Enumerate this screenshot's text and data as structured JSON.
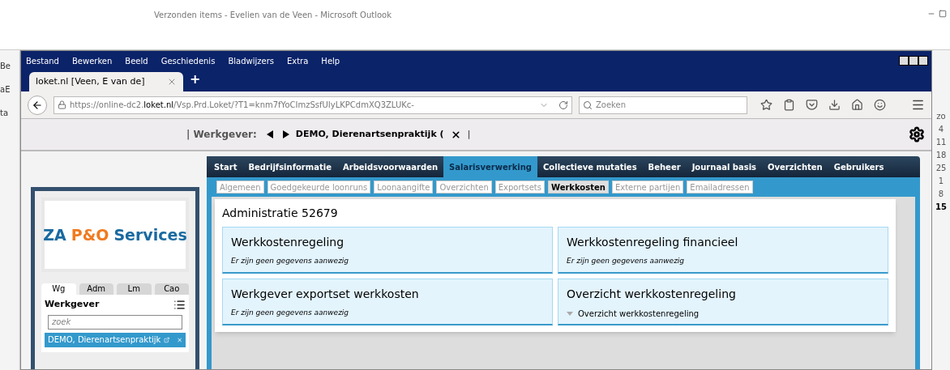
{
  "outlook": {
    "title": "Verzonden items - Evelien van de Veen  -  Microsoft Outlook",
    "left_fragments": [
      "Be",
      "aE",
      "ta"
    ],
    "calendar_days": [
      {
        "label": "zo",
        "bold": false
      },
      {
        "label": "4",
        "bold": false
      },
      {
        "label": "11",
        "bold": false
      },
      {
        "label": "18",
        "bold": false
      },
      {
        "label": "25",
        "bold": false
      },
      {
        "label": "1",
        "bold": false
      },
      {
        "label": "8",
        "bold": false
      },
      {
        "label": "15",
        "bold": true
      }
    ]
  },
  "browser": {
    "menu": [
      "Bestand",
      "Bewerken",
      "Beeld",
      "Geschiedenis",
      "Bladwijzers",
      "Extra",
      "Help"
    ],
    "tabs": [
      {
        "label": "loket.nl [Veen, E van de]",
        "selected": true
      }
    ],
    "new_tab": "+",
    "url": {
      "prefix": "https://online-dc2.",
      "domain": "loket.nl",
      "path": "/Vsp.Prd.Loket/?T1=knm7fYoCImzSsfUIyLKPCdmXQ3ZLUKc-"
    },
    "search": {
      "placeholder": "Zoeken"
    }
  },
  "header": {
    "label": "| Werkgever:",
    "employer": "DEMO, Dierenartsenpraktijk (",
    "separator": "|"
  },
  "sidebar": {
    "logo": {
      "part1": "ZA",
      "part2": "P&O",
      "part3": "Services"
    },
    "tabs": [
      {
        "label": "Wg",
        "selected": true
      },
      {
        "label": "Adm",
        "selected": false
      },
      {
        "label": "Lm",
        "selected": false
      },
      {
        "label": "Cao",
        "selected": false
      }
    ],
    "title": "Werkgever",
    "search": {
      "placeholder": "zoek"
    },
    "items": [
      {
        "label": "DEMO, Dierenartsenpraktijk",
        "selected": true
      }
    ]
  },
  "nav": [
    {
      "label": "Start",
      "selected": false
    },
    {
      "label": "Bedrijfsinformatie",
      "selected": false
    },
    {
      "label": "Arbeidsvoorwaarden",
      "selected": false
    },
    {
      "label": "Salarisverwerking",
      "selected": true
    },
    {
      "label": "Collectieve mutaties",
      "selected": false
    },
    {
      "label": "Beheer",
      "selected": false
    },
    {
      "label": "Journaal basis",
      "selected": false
    },
    {
      "label": "Overzichten",
      "selected": false
    },
    {
      "label": "Gebruikers",
      "selected": false
    }
  ],
  "subtabs": [
    {
      "label": "Algemeen",
      "selected": false
    },
    {
      "label": "Goedgekeurde loonruns",
      "selected": false
    },
    {
      "label": "Loonaangifte",
      "selected": false
    },
    {
      "label": "Overzichten",
      "selected": false
    },
    {
      "label": "Exportsets",
      "selected": false
    },
    {
      "label": "Werkkosten",
      "selected": true
    },
    {
      "label": "Externe partijen",
      "selected": false
    },
    {
      "label": "Emailadressen",
      "selected": false
    }
  ],
  "content": {
    "title": "Administratie  52679",
    "panels": [
      {
        "title": "Werkkostenregeling",
        "kind": "empty",
        "text": "Er zijn geen gegevens aanwezig"
      },
      {
        "title": "Werkkostenregeling financieel",
        "kind": "empty",
        "text": "Er zijn geen gegevens aanwezig"
      },
      {
        "title": "Werkgever exportset werkkosten",
        "kind": "empty",
        "text": "Er zijn geen gegevens aanwezig"
      },
      {
        "title": "Overzicht werkkostenregeling",
        "kind": "link",
        "text": "Overzicht werkkostenregeling"
      }
    ]
  }
}
